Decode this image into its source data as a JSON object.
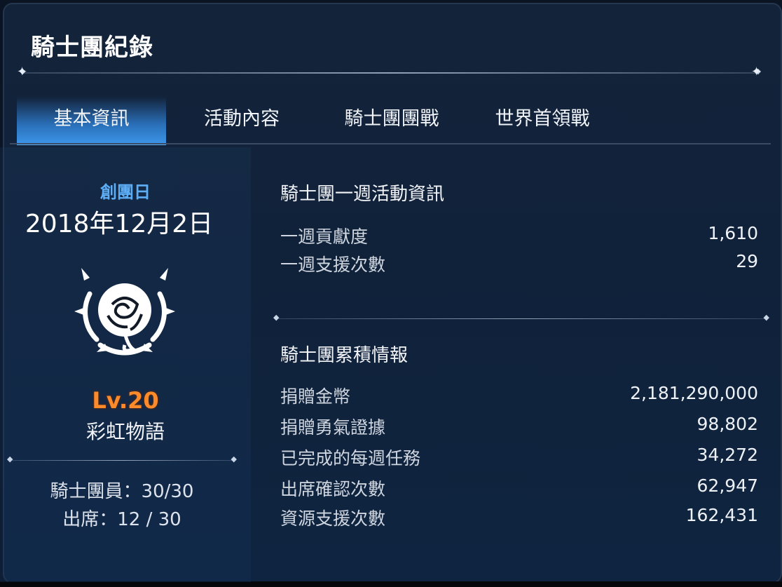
{
  "window": {
    "title": "騎士團紀錄"
  },
  "tabs": [
    {
      "label": "基本資訊",
      "active": true
    },
    {
      "label": "活動內容",
      "active": false
    },
    {
      "label": "騎士團團戰",
      "active": false
    },
    {
      "label": "世界首領戰",
      "active": false
    }
  ],
  "guild": {
    "founded_label": "創團日",
    "founded_date": "2018年12月2日",
    "emblem_icon": "rose-emblem-icon",
    "level": "Lv.20",
    "name": "彩虹物語",
    "members": "騎士團員：30/30",
    "attendance": "出席：12 / 30"
  },
  "weekly": {
    "title": "騎士團一週活動資訊",
    "rows": [
      {
        "label": "一週貢獻度",
        "value": "1,610"
      },
      {
        "label": "一週支援次數",
        "value": "29"
      }
    ]
  },
  "cumulative": {
    "title": "騎士團累積情報",
    "rows": [
      {
        "label": "捐贈金幣",
        "value": "2,181,290,000"
      },
      {
        "label": "捐贈勇氣證據",
        "value": "98,802"
      },
      {
        "label": "已完成的每週任務",
        "value": "34,272"
      },
      {
        "label": "出席確認次數",
        "value": "62,947"
      },
      {
        "label": "資源支援次數",
        "value": "162,431"
      }
    ]
  },
  "colors": {
    "accent_blue": "#5eaef5",
    "tab_active": "#3b93e6",
    "level_orange": "#ff8a2a"
  }
}
